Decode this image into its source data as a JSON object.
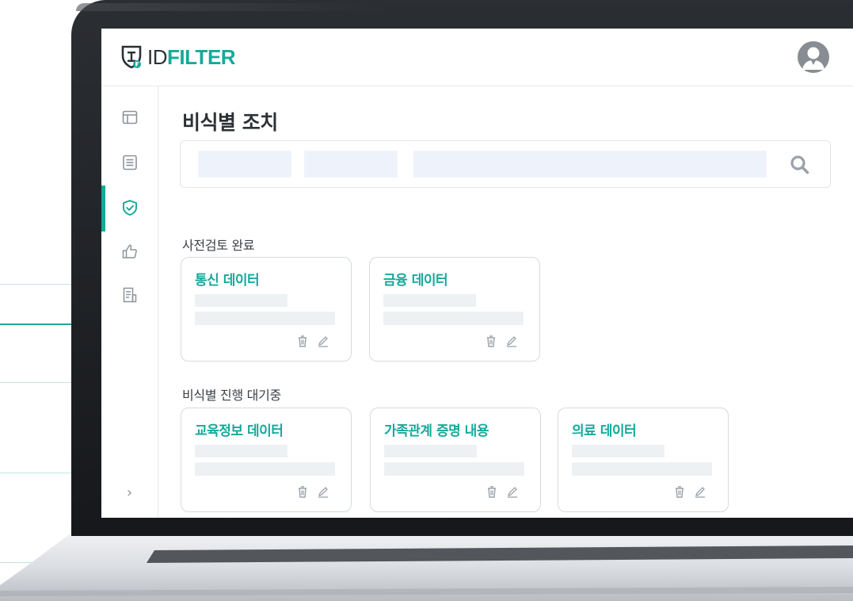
{
  "app": {
    "logo_id": "ID",
    "logo_filter": "FILTER"
  },
  "page": {
    "title": "비식별 조치"
  },
  "sidebar": {
    "items": [
      {
        "icon": "layout-icon"
      },
      {
        "icon": "list-icon"
      },
      {
        "icon": "shield-check-icon",
        "active": true
      },
      {
        "icon": "thumbs-up-icon"
      },
      {
        "icon": "report-icon"
      }
    ],
    "expand_icon": "›"
  },
  "sections": [
    {
      "title": "사전검토 완료",
      "cards": [
        {
          "title": "통신 데이터"
        },
        {
          "title": "금융 데이터"
        }
      ]
    },
    {
      "title": "비식별 진행 대기중",
      "cards": [
        {
          "title": "교육정보 데이터"
        },
        {
          "title": "가족관계 증명 내용"
        },
        {
          "title": "의료 데이터"
        }
      ]
    }
  ],
  "colors": {
    "accent": "#16a99a",
    "text": "#2c3136",
    "placeholder": "#eef1f4",
    "search_field": "#eef3fb"
  }
}
